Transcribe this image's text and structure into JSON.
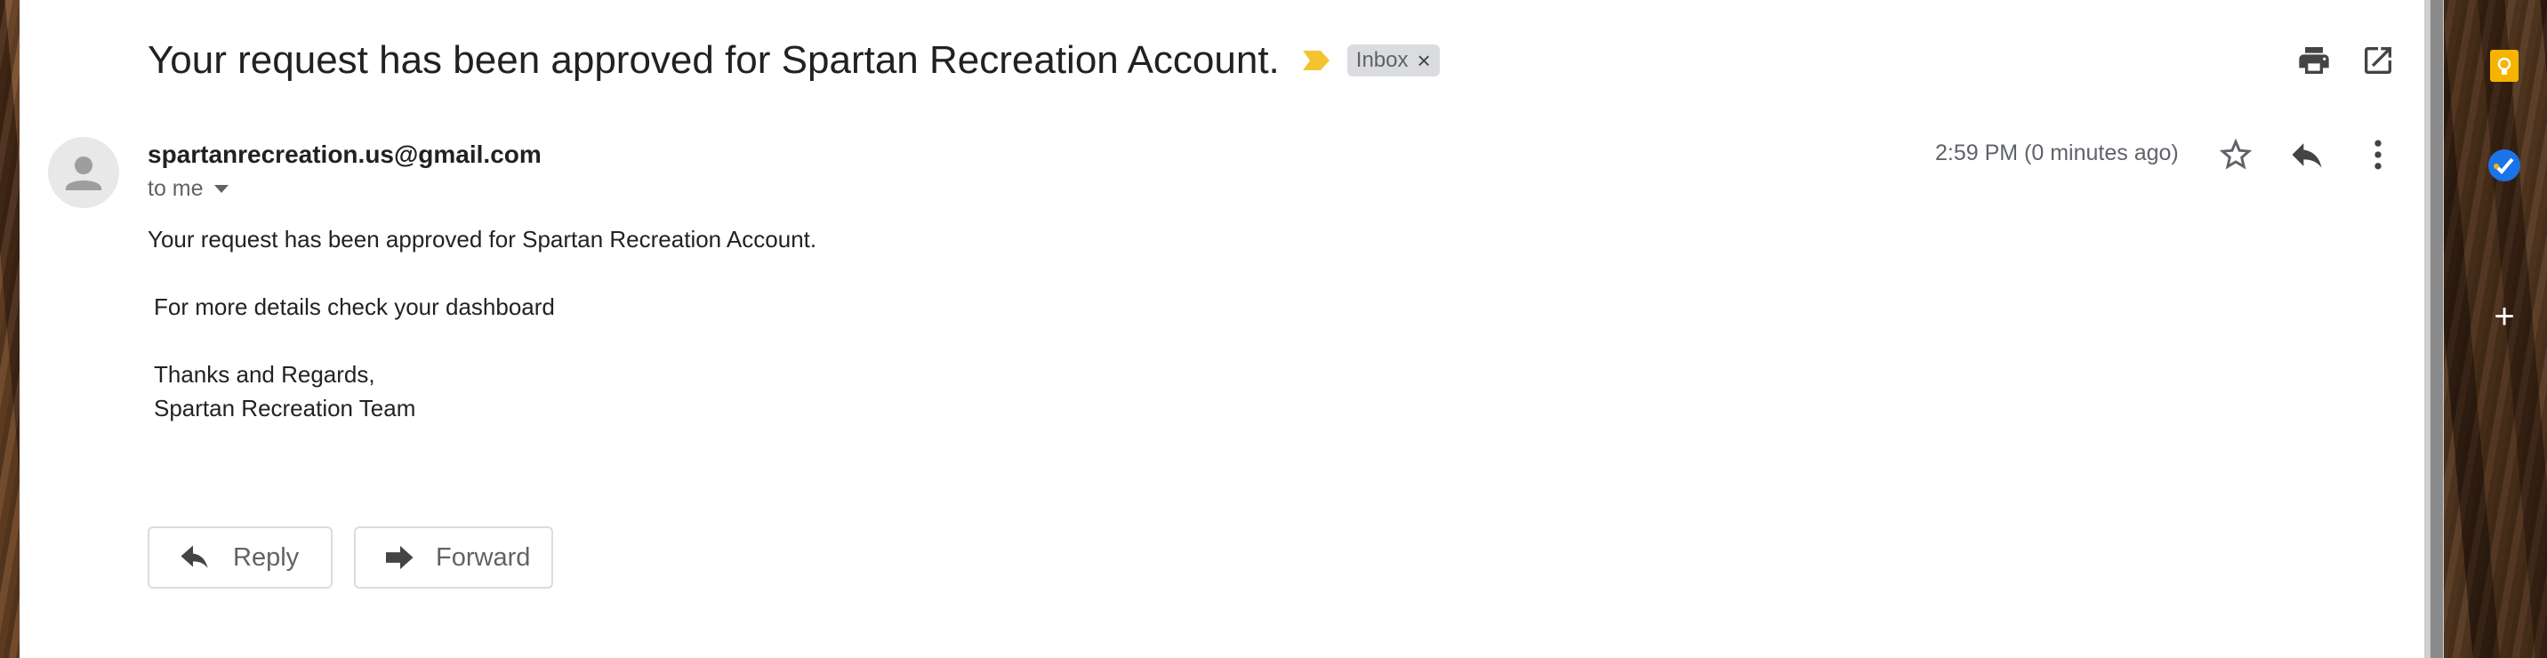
{
  "email": {
    "subject": "Your request has been approved for Spartan Recreation Account.",
    "label_chip": "Inbox",
    "label_chip_close": "×",
    "sender": "spartanrecreation.us@gmail.com",
    "recipient_line": "to me",
    "time": "2:59 PM (0 minutes ago)",
    "body": {
      "line1": "Your request has been approved for Spartan Recreation Account.",
      "line2": "For more details check your dashboard",
      "line3": "Thanks and Regards,",
      "line4": "Spartan Recreation Team"
    }
  },
  "actions": {
    "reply_label": "Reply",
    "forward_label": "Forward"
  },
  "side_panel": {
    "add_label": "+"
  },
  "icons": {
    "label_arrow": "label-important-icon",
    "print": "print-icon",
    "open_new_window": "open-in-new-icon",
    "star": "star-outline-icon",
    "reply": "reply-icon",
    "more": "more-vert-icon",
    "keep": "keep-icon",
    "tasks": "tasks-icon"
  },
  "colors": {
    "important_marker": "#f4c430",
    "keep_accent": "#f6b400",
    "tasks_accent": "#1a73e8"
  }
}
